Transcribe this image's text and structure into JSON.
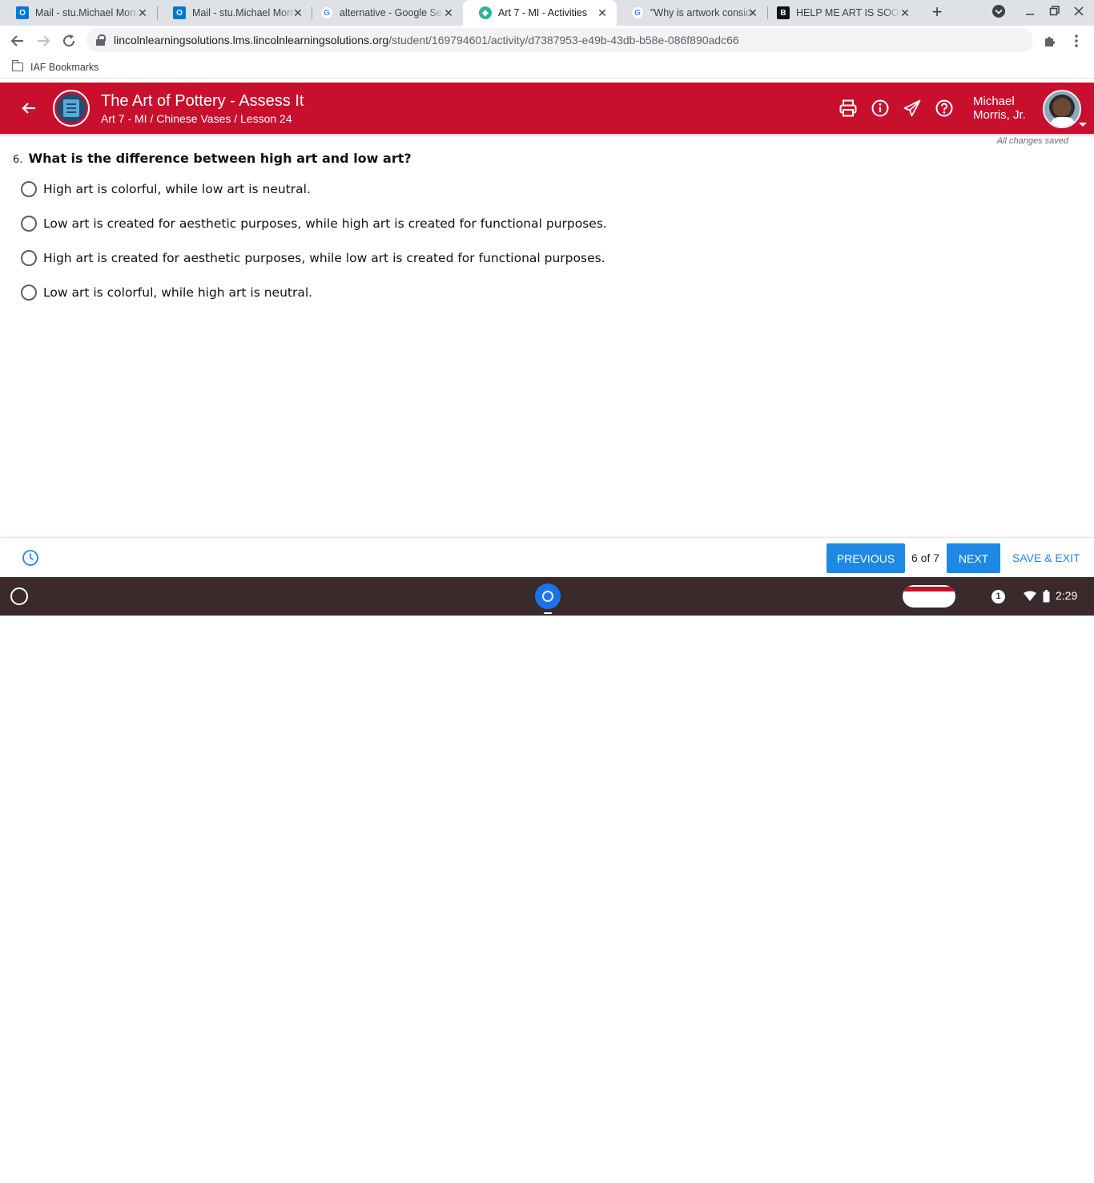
{
  "browser": {
    "tabs": [
      {
        "title": "Mail - stu.Michael Morris",
        "favicon": "outlook-icon",
        "favicon_color": "#0078d4",
        "active": false
      },
      {
        "title": "Mail - stu.Michael Morris",
        "favicon": "outlook-icon",
        "favicon_color": "#0078d4",
        "active": false
      },
      {
        "title": "alternative - Google Search",
        "favicon": "google-icon",
        "favicon_color": "#4285f4",
        "active": false
      },
      {
        "title": "Art 7 - MI - Activities",
        "favicon": "lincoln-icon",
        "favicon_color": "#2bb3a0",
        "active": true
      },
      {
        "title": "\"Why is artwork considered",
        "favicon": "google-icon",
        "favicon_color": "#4285f4",
        "active": false
      },
      {
        "title": "HELP ME ART IS SOOOO",
        "favicon": "brainly-icon",
        "favicon_color": "#111111",
        "active": false
      }
    ],
    "url_host": "lincolnlearningsolutions.lms.lincolnlearningsolutions.org",
    "url_path": "/student/169794601/activity/d7387953-e49b-43db-b58e-086f890adc66",
    "bookmark_folder": "IAF Bookmarks"
  },
  "header": {
    "title": "The Art of Pottery - Assess It",
    "subtitle": "Art 7 - MI / Chinese Vases / Lesson 24",
    "user_name_line1": "Michael",
    "user_name_line2": "Morris, Jr.",
    "brand_color": "#c8102e"
  },
  "status": {
    "saved_text": "All changes saved"
  },
  "question": {
    "number": "6.",
    "text": "What is the difference between high art and low art?",
    "options": [
      "High art is colorful, while low art is neutral.",
      "Low art is created for aesthetic purposes, while high art is created for functional purposes.",
      "High art is created for aesthetic purposes, while low art is created for functional purposes.",
      "Low art is colorful, while high art is neutral."
    ]
  },
  "footer": {
    "previous_label": "PREVIOUS",
    "page_info": "6 of 7",
    "next_label": "NEXT",
    "save_exit_label": "SAVE & EXIT",
    "accent_color": "#1e88e5"
  },
  "shelf": {
    "notification_count": "1",
    "time": "2:29"
  }
}
